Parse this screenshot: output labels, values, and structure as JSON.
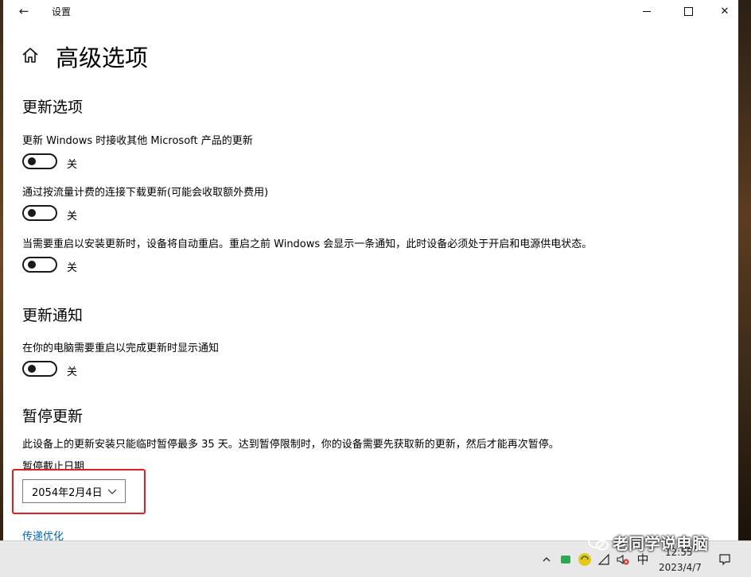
{
  "window": {
    "title": "设置",
    "back_glyph": "←",
    "controls": {
      "minimize": "minimize-icon",
      "maximize": "maximize-icon",
      "close_glyph": "✕"
    }
  },
  "page": {
    "title": "高级选项",
    "home_icon": "home-icon"
  },
  "update_options": {
    "title": "更新选项",
    "settings": [
      {
        "label": "更新 Windows 时接收其他 Microsoft 产品的更新",
        "state": "关"
      },
      {
        "label": "通过按流量计费的连接下载更新(可能会收取额外费用)",
        "state": "关"
      },
      {
        "label": "当需要重启以安装更新时，设备将自动重启。重启之前 Windows 会显示一条通知，此时设备必须处于开启和电源供电状态。",
        "state": "关"
      }
    ]
  },
  "update_notify": {
    "title": "更新通知",
    "settings": [
      {
        "label": "在你的电脑需要重启以完成更新时显示通知",
        "state": "关"
      }
    ]
  },
  "pause_updates": {
    "title": "暂停更新",
    "description": "此设备上的更新安装只能临时暂停最多 35 天。达到暂停限制时，你的设备需要先获取新的更新，然后才能再次暂停。",
    "date_label": "暂停截止日期",
    "date_value": "2054年2月4日"
  },
  "link_partial": "传递优化",
  "accent": {
    "highlight": "#e02020",
    "link": "#0063b1"
  },
  "taskbar": {
    "input_method": "中",
    "time": "12:55",
    "date": "2023/4/7",
    "watermark": "老同学说电脑",
    "icons": [
      "chevron-up-icon",
      "tray-app-icon",
      "network-icon",
      "volume-muted-icon",
      "notification-icon"
    ]
  }
}
